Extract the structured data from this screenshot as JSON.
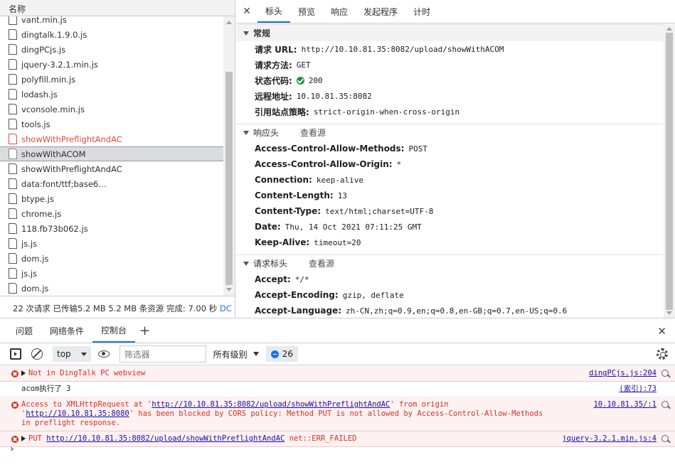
{
  "network": {
    "name_header": "名称",
    "files": [
      {
        "name": "vant.min.js",
        "state": "normal"
      },
      {
        "name": "dingtalk.1.9.0.js",
        "state": "normal"
      },
      {
        "name": "dingPCjs.js",
        "state": "normal"
      },
      {
        "name": "jquery-3.2.1.min.js",
        "state": "normal"
      },
      {
        "name": "polyfill.min.js",
        "state": "normal"
      },
      {
        "name": "lodash.js",
        "state": "normal"
      },
      {
        "name": "vconsole.min.js",
        "state": "normal"
      },
      {
        "name": "tools.js",
        "state": "normal"
      },
      {
        "name": "showWithPreflightAndAC",
        "state": "error"
      },
      {
        "name": "showWithACOM",
        "state": "selected"
      },
      {
        "name": "showWithPreflightAndAC",
        "state": "normal"
      },
      {
        "name": "data:font/ttf;base6…",
        "state": "normal"
      },
      {
        "name": "btype.js",
        "state": "normal"
      },
      {
        "name": "chrome.js",
        "state": "normal"
      },
      {
        "name": "118.fb73b062.js",
        "state": "normal"
      },
      {
        "name": "js.js",
        "state": "normal"
      },
      {
        "name": "dom.js",
        "state": "normal"
      },
      {
        "name": "js.js",
        "state": "normal"
      },
      {
        "name": "dom.js",
        "state": "normal"
      }
    ],
    "status_text": "22 次请求  已传输5.2 MB  5.2 MB 条资源  完成: 7.00 秒",
    "status_link": "DC"
  },
  "detail": {
    "close_glyph": "✕",
    "tabs": [
      {
        "label": "标头",
        "active": true
      },
      {
        "label": "预览",
        "active": false
      },
      {
        "label": "响应",
        "active": false
      },
      {
        "label": "发起程序",
        "active": false
      },
      {
        "label": "计时",
        "active": false
      }
    ],
    "general": {
      "title": "常规",
      "request_url_key": "请求 URL:",
      "request_url": "http://10.10.81.35:8082/upload/showWithACOM",
      "method_key": "请求方法:",
      "method": "GET",
      "status_key": "状态代码:",
      "status": "200",
      "remote_key": "远程地址:",
      "remote": "10.10.81.35:8082",
      "referrer_key": "引用站点策略:",
      "referrer": "strict-origin-when-cross-origin"
    },
    "response_headers": {
      "title": "响应头",
      "view_source": "查看源",
      "items": [
        {
          "k": "Access-Control-Allow-Methods:",
          "v": "POST"
        },
        {
          "k": "Access-Control-Allow-Origin:",
          "v": "*"
        },
        {
          "k": "Connection:",
          "v": "keep-alive"
        },
        {
          "k": "Content-Length:",
          "v": "13"
        },
        {
          "k": "Content-Type:",
          "v": "text/html;charset=UTF-8"
        },
        {
          "k": "Date:",
          "v": "Thu, 14 Oct 2021 07:11:25 GMT"
        },
        {
          "k": "Keep-Alive:",
          "v": "timeout=20"
        }
      ]
    },
    "request_headers": {
      "title": "请求标头",
      "view_source": "查看源",
      "items": [
        {
          "k": "Accept:",
          "v": "*/*"
        },
        {
          "k": "Accept-Encoding:",
          "v": "gzip, deflate"
        },
        {
          "k": "Accept-Language:",
          "v": "zh-CN,zh;q=0.9,en;q=0.8,en-GB;q=0.7,en-US;q=0.6"
        }
      ]
    }
  },
  "drawer": {
    "tabs": [
      {
        "label": "问题",
        "active": false
      },
      {
        "label": "网络条件",
        "active": false
      },
      {
        "label": "控制台",
        "active": true
      }
    ],
    "plus": "+",
    "close": "✕",
    "toolbar": {
      "context": "top",
      "filter_placeholder": "筛选器",
      "levels": "所有级别",
      "message_count": "26"
    },
    "messages": [
      {
        "type": "error",
        "expandable": true,
        "text": "Not in DingTalk PC webview",
        "source": "dingPCjs.js:204"
      },
      {
        "type": "log",
        "text": "acom执行了 3",
        "source": "(索引):73"
      },
      {
        "type": "error",
        "expandable": false,
        "pre": "Access to XMLHttpRequest at '",
        "link1": "http://10.10.81.35:8082/upload/showWithPreflightAndAC",
        "mid": "' from origin '",
        "link2": "http://10.10.81.35:8080",
        "post": "' has been blocked by CORS policy: Method PUT is not allowed by Access-Control-Allow-Methods in preflight response.",
        "source": "10.10.81.35/:1"
      },
      {
        "type": "error",
        "expandable": true,
        "pre": "PUT ",
        "link1": "http://10.10.81.35:8082/upload/showWithPreflightAndAC",
        "post": " net::ERR_FAILED",
        "source": "jquery-3.2.1.min.js:4"
      }
    ],
    "prompt": "›"
  }
}
